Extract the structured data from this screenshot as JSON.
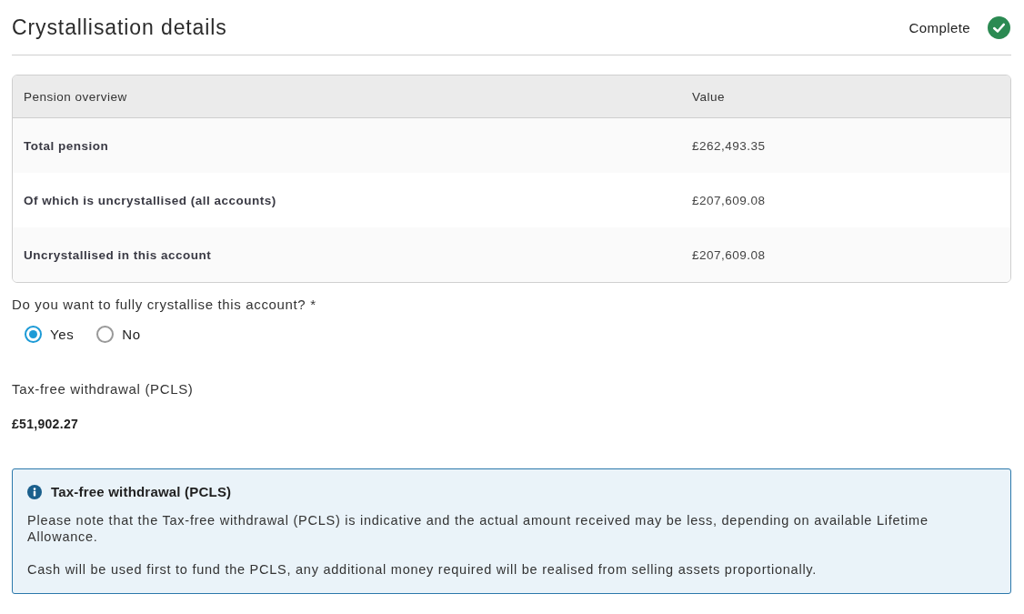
{
  "header": {
    "title": "Crystallisation details",
    "status": {
      "label": "Complete",
      "kind": "complete"
    }
  },
  "table": {
    "columns": [
      "Pension overview",
      "Value"
    ],
    "rows": [
      {
        "label": "Total pension",
        "value": "£262,493.35"
      },
      {
        "label": "Of which is uncrystallised (all accounts)",
        "value": "£207,609.08"
      },
      {
        "label": "Uncrystallised in this account",
        "value": "£207,609.08"
      }
    ]
  },
  "question": {
    "label": "Do you want to fully crystallise this account? *",
    "options": [
      {
        "label": "Yes",
        "selected": true
      },
      {
        "label": "No",
        "selected": false
      }
    ]
  },
  "result": {
    "label": "Tax-free withdrawal (PCLS)",
    "value": "£51,902.27"
  },
  "notice": {
    "kind": "info",
    "title": "Tax-free withdrawal (PCLS)",
    "paragraphs": [
      "Please note that the Tax-free withdrawal (PCLS) is indicative and the actual amount received may be less, depending on available Lifetime Allowance.",
      "Cash will be used first to fund the PCLS, any additional money required will be realised from selling assets proportionally."
    ]
  }
}
